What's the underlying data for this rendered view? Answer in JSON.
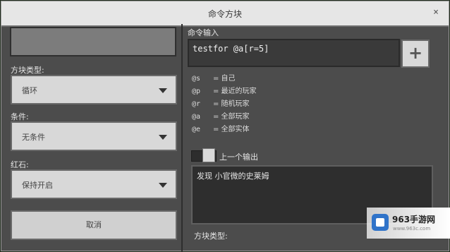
{
  "window": {
    "title": "命令方块",
    "close_glyph": "×"
  },
  "left": {
    "name_placeholder": "",
    "block_type_label": "方块类型:",
    "block_type_value": "循环",
    "condition_label": "条件:",
    "condition_value": "无条件",
    "redstone_label": "红石:",
    "redstone_value": "保持开启",
    "cancel_label": "取消"
  },
  "right": {
    "command_label": "命令输入",
    "command_value": "testfor @a[r=5]",
    "add_button": "+",
    "legend": [
      {
        "key": "@s",
        "desc": "= 自己"
      },
      {
        "key": "@p",
        "desc": "= 最近的玩家"
      },
      {
        "key": "@r",
        "desc": "= 随机玩家"
      },
      {
        "key": "@a",
        "desc": "= 全部玩家"
      },
      {
        "key": "@e",
        "desc": "= 全部实体"
      }
    ],
    "previous_output_label": "上一个输出",
    "previous_output_enabled": true,
    "output_text": "发现 小官微的史莱姆",
    "bottom_label": "方块类型:"
  },
  "watermark": {
    "title": "963手游网",
    "url": "www.963c.com"
  },
  "icons": {
    "caret": "chevron-down-icon",
    "add": "plus-icon",
    "close": "close-icon"
  }
}
